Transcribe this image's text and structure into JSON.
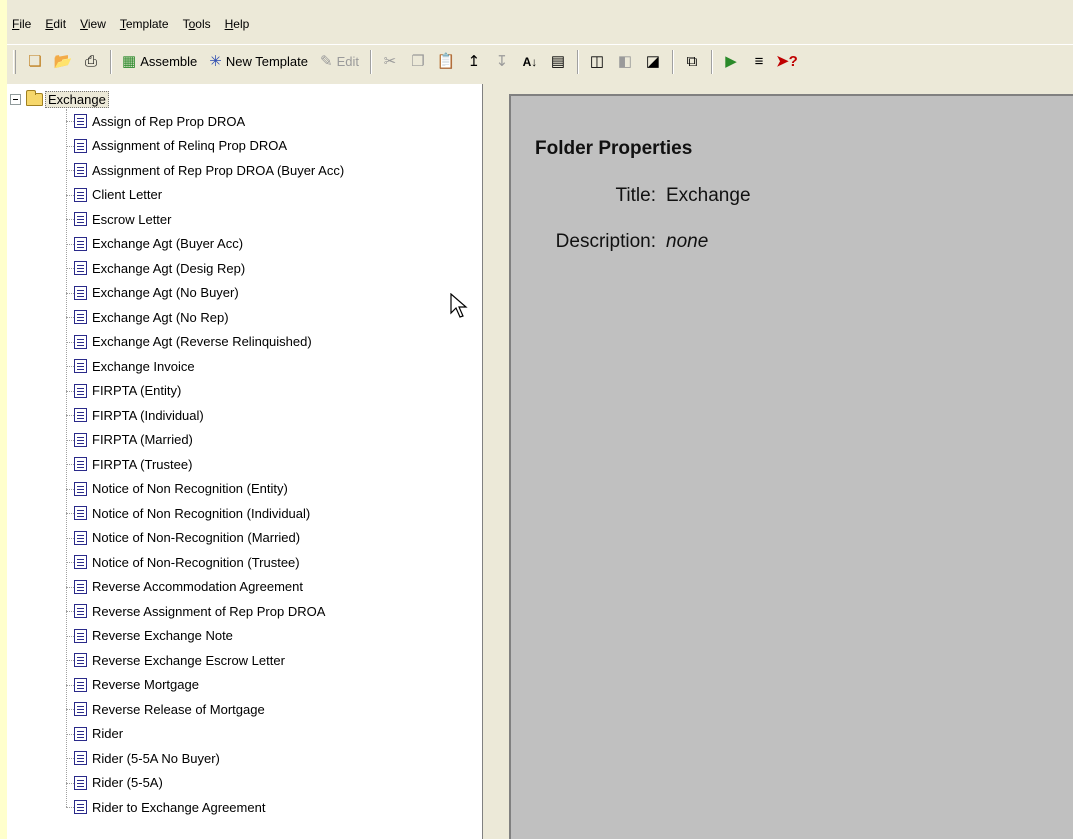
{
  "menu": [
    {
      "label": "File",
      "accel": "F",
      "rest": "ile"
    },
    {
      "label": "Edit",
      "accel": "E",
      "rest": "dit"
    },
    {
      "label": "View",
      "accel": "V",
      "rest": "iew"
    },
    {
      "label": "Template",
      "accel": "T",
      "rest": "emplate"
    },
    {
      "label": "Tools",
      "accel": "T",
      "pre": "",
      "rest": "ools"
    },
    {
      "label": "Help",
      "accel": "H",
      "rest": "elp"
    }
  ],
  "toolbar": {
    "assemble_label": "Assemble",
    "new_template_label": "New Template",
    "edit_label": "Edit"
  },
  "tree": {
    "root_label": "Exchange",
    "items": [
      "Assign of Rep Prop DROA",
      "Assignment of Relinq Prop DROA",
      "Assignment of Rep Prop DROA (Buyer Acc)",
      "Client Letter",
      "Escrow Letter",
      "Exchange Agt (Buyer Acc)",
      "Exchange Agt (Desig Rep)",
      "Exchange Agt (No Buyer)",
      "Exchange Agt (No Rep)",
      "Exchange Agt (Reverse Relinquished)",
      "Exchange Invoice",
      "FIRPTA (Entity)",
      "FIRPTA (Individual)",
      "FIRPTA (Married)",
      "FIRPTA (Trustee)",
      "Notice of Non Recognition (Entity)",
      "Notice of Non Recognition (Individual)",
      "Notice of Non-Recognition (Married)",
      "Notice of Non-Recognition (Trustee)",
      "Reverse Accommodation Agreement",
      "Reverse Assignment of Rep Prop DROA",
      "Reverse Exchange Note",
      "Reverse Exchange Escrow Letter",
      "Reverse Mortgage",
      "Reverse Release of Mortgage",
      "Rider",
      "Rider (5-5A No Buyer)",
      "Rider (5-5A)",
      "Rider to Exchange Agreement"
    ]
  },
  "properties": {
    "heading": "Folder Properties",
    "title_label": "Title:",
    "title_value": "Exchange",
    "description_label": "Description:",
    "description_value": "none"
  },
  "colors": {
    "desktop": "#ffffcc",
    "chrome": "#ece9d8",
    "properties_bg": "#c0c0c0"
  }
}
